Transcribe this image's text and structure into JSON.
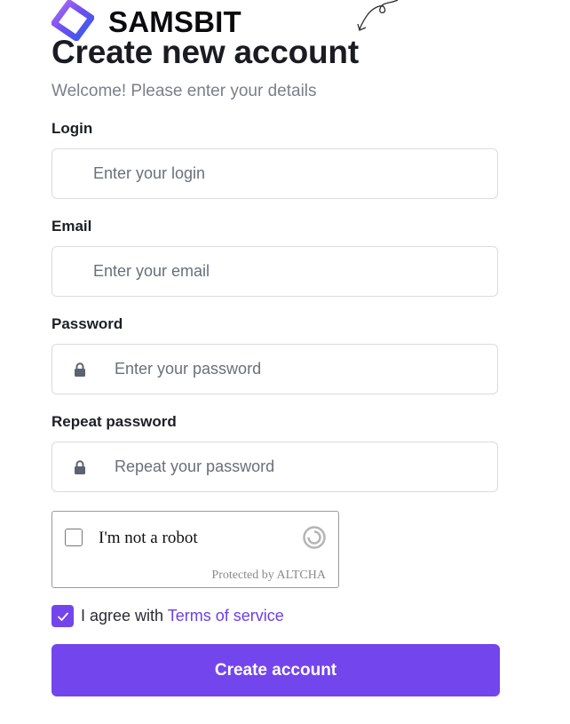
{
  "brand": {
    "name": "SAMSBIT",
    "logo_icon": "samsbit-logo-icon"
  },
  "page": {
    "title": "Create new account",
    "subtitle": "Welcome! Please enter your details"
  },
  "form": {
    "login": {
      "label": "Login",
      "placeholder": "Enter your login",
      "value": ""
    },
    "email": {
      "label": "Email",
      "placeholder": "Enter your email",
      "value": ""
    },
    "password": {
      "label": "Password",
      "placeholder": "Enter your password",
      "value": "",
      "icon": "lock-icon"
    },
    "repeat_password": {
      "label": "Repeat password",
      "placeholder": "Repeat your password",
      "value": "",
      "icon": "lock-icon"
    }
  },
  "captcha": {
    "label": "I'm not a robot",
    "footer": "Protected by ALTCHA",
    "checked": false,
    "icon": "altcha-refresh-icon"
  },
  "agreement": {
    "text": "I agree with ",
    "link_text": "Terms of service",
    "checked": true,
    "icon": "checkmark-icon"
  },
  "submit": {
    "label": "Create account"
  },
  "colors": {
    "accent": "#7345ec",
    "link": "#6b3fe6",
    "border": "#d9dbe1",
    "muted_text": "#7b7f8c"
  }
}
